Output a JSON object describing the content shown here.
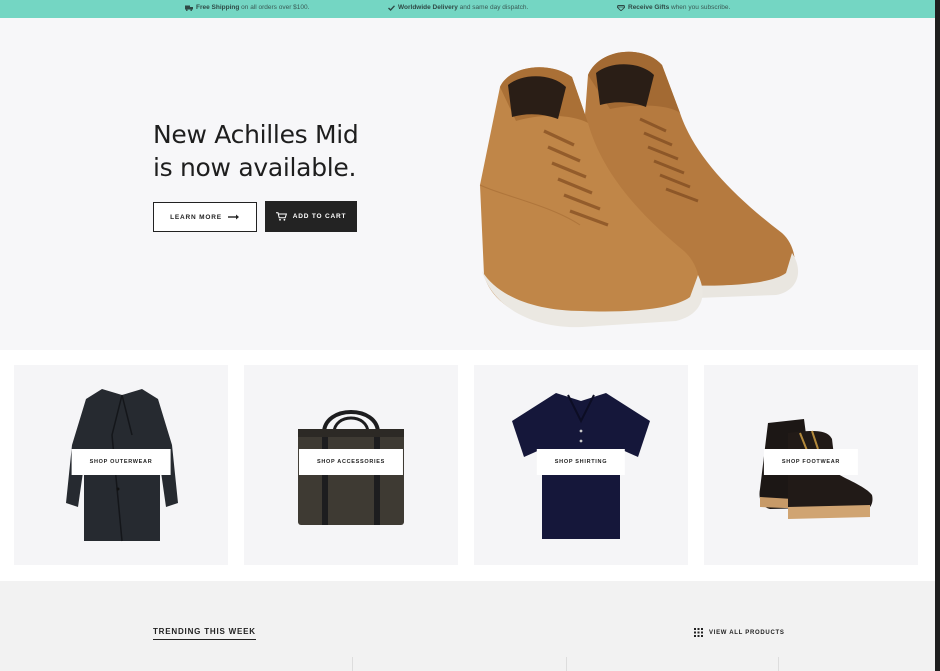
{
  "topbar": {
    "promo1_bold": "Free Shipping",
    "promo1_rest": "on all orders over $100.",
    "promo1_icon": "truck-icon",
    "promo2_bold": "Worldwide Delivery",
    "promo2_rest": "and same day dispatch.",
    "promo2_icon": "check-icon",
    "promo3_bold": "Receive Gifts",
    "promo3_rest": "when you subscribe.",
    "promo3_icon": "diamond-icon",
    "color": "#74d6c3"
  },
  "hero": {
    "title_line1": "New Achilles Mid",
    "title_line2": "is now available.",
    "learn_more": "LEARN MORE",
    "add_to_cart": "ADD TO CART",
    "image": "suede-sneakers"
  },
  "categories": [
    {
      "label": "SHOP OUTERWEAR",
      "image": "coat"
    },
    {
      "label": "SHOP ACCESSORIES",
      "image": "bag"
    },
    {
      "label": "SHOP SHIRTING",
      "image": "polo-shirt"
    },
    {
      "label": "SHOP FOOTWEAR",
      "image": "boots"
    }
  ],
  "trending": {
    "title": "TRENDING THIS WEEK",
    "view_all": "VIEW ALL PRODUCTS"
  }
}
